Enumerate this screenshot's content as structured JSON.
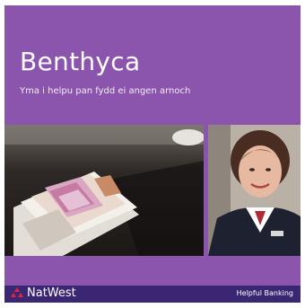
{
  "card": {
    "title": "Benthyca",
    "subtitle": "Yma i helpu pan fydd ei angen arnoch"
  },
  "footer": {
    "brand": "NatWest",
    "tagline": "Helpful Banking"
  },
  "colors": {
    "purple": "#8c55ad",
    "footer_navy": "#3a2673",
    "logo_red": "#e0263a"
  },
  "images": {
    "left": "fabric-swatches-on-table-photo",
    "right": "smiling-bank-employee-photo"
  }
}
